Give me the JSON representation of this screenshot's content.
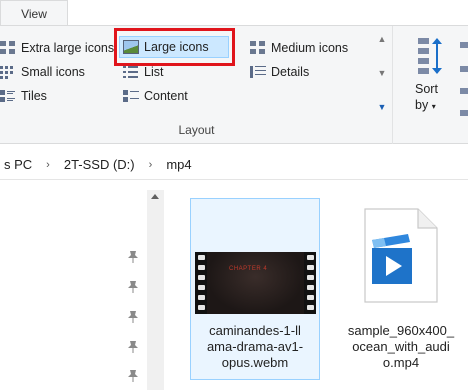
{
  "ribbon": {
    "active_tab": "View",
    "layout_group": {
      "label": "Layout",
      "options": {
        "extra_large": "Extra large icons",
        "large": "Large icons",
        "medium": "Medium icons",
        "small": "Small icons",
        "list": "List",
        "details": "Details",
        "tiles": "Tiles",
        "content": "Content"
      },
      "selected": "Large icons"
    },
    "sort": {
      "label_line1": "Sort",
      "label_line2": "by"
    }
  },
  "address": {
    "crumbs": [
      "s PC",
      "2T-SSD (D:)",
      "mp4"
    ]
  },
  "files": [
    {
      "name": "caminandes-1-llama-drama-av1-opus.webm",
      "line1": "caminandes-1-ll",
      "line2": "ama-drama-av1-",
      "line3": "opus.webm",
      "thumb_caption": "CHAPTER 4"
    },
    {
      "name": "sample_960x400_ocean_with_audio.mp4",
      "line1": "sample_960x400_",
      "line2": "ocean_with_audi",
      "line3": "o.mp4"
    }
  ],
  "colors": {
    "selection_fill": "#cce8ff",
    "selection_border": "#99d1ff",
    "highlight": "#e0141b",
    "ribbon_bg": "#f5f6f7",
    "video_blue": "#1e73c9"
  }
}
